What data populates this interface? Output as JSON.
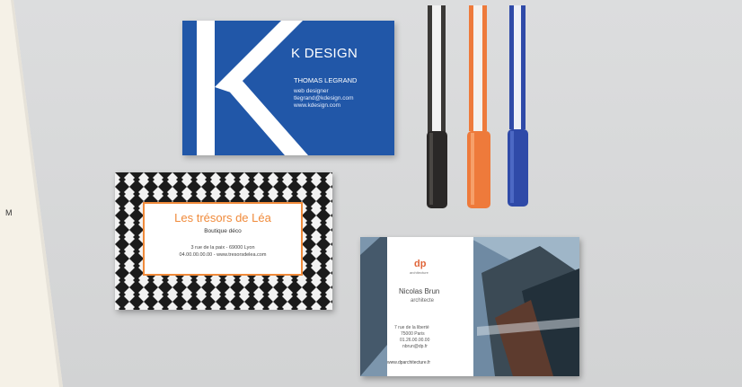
{
  "edge_label": "M",
  "card_k": {
    "brand": "K DESIGN",
    "name": "THOMAS LEGRAND",
    "role": "web designer",
    "email": "tlegrand@kdesign.com",
    "web": "www.kdesign.com"
  },
  "card_pattern": {
    "title": "Les trésors de Léa",
    "subtitle": "Boutique déco",
    "address": "3 rue de la paix - 69000 Lyon",
    "contact": "04.00.00.00.00 - www.tresorsdelea.com"
  },
  "card_arch": {
    "logo": "dp",
    "logo_sub": "architecture",
    "name": "Nicolas Brun",
    "role": "architecte",
    "address_lines": [
      "7 rue de la liberté",
      "75000 Paris",
      "01.26.00.00.00",
      "nbrun@dp.fr"
    ],
    "web": "www.dparchitecture.fr"
  },
  "colors": {
    "k_blue": "#2157a8",
    "accent_orange": "#f08a3a",
    "pen_black": "#2a2827",
    "pen_orange": "#ee7a3b",
    "pen_blue": "#2f4aa8"
  }
}
